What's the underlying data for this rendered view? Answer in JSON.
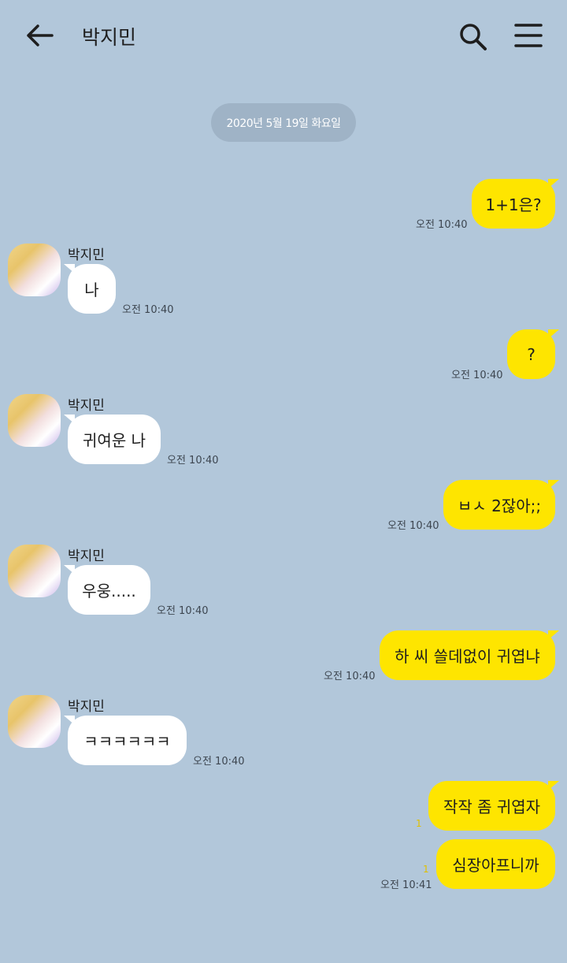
{
  "header": {
    "title": "박지민",
    "back_icon": "arrow-left-icon",
    "search_icon": "search-icon",
    "menu_icon": "hamburger-menu-icon"
  },
  "date_divider": "2020년 5월 19일 화요일",
  "colors": {
    "background": "#b2c7da",
    "my_bubble": "#fee500",
    "their_bubble": "#ffffff",
    "date_pill": "#9fb3c6",
    "unread_count": "#e0c000"
  },
  "messages": [
    {
      "from": "me",
      "text": "1+1은?",
      "time": "오전 10:40"
    },
    {
      "from": "them",
      "sender": "박지민",
      "text": "나",
      "time": "오전 10:40"
    },
    {
      "from": "me",
      "text": "?",
      "time": "오전 10:40"
    },
    {
      "from": "them",
      "sender": "박지민",
      "text": "귀여운 나",
      "time": "오전 10:40"
    },
    {
      "from": "me",
      "text": "ㅂㅅ 2잖아;;",
      "time": "오전 10:40"
    },
    {
      "from": "them",
      "sender": "박지민",
      "text": "우웅.....",
      "time": "오전 10:40"
    },
    {
      "from": "me",
      "text": "하 씨 쓸데없이 귀엽냐",
      "time": "오전 10:40"
    },
    {
      "from": "them",
      "sender": "박지민",
      "text": "ㅋㅋㅋㅋㅋㅋ",
      "time": "오전 10:40"
    },
    {
      "from": "me",
      "text": "작작 좀 귀엽자",
      "unread": "1"
    },
    {
      "from": "me",
      "text": "심장아프니까",
      "unread": "1",
      "time": "오전 10:41"
    }
  ]
}
